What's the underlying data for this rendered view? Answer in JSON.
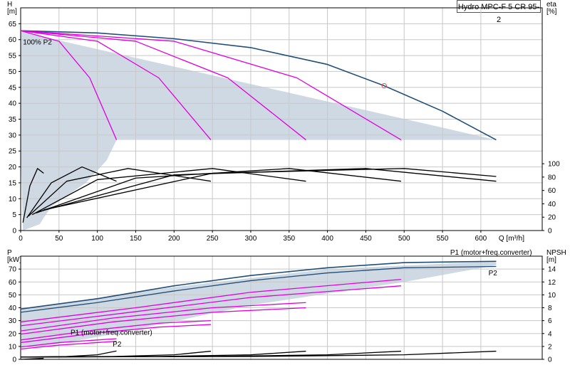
{
  "title": "Hydro MPC-F 5 CR 95-2",
  "colors": {
    "envelope": "#cfd9e4",
    "curve_max": "#1f4e79",
    "curve_speed": "#e000e0",
    "curve_eff": "#000000",
    "grid": "#c8c8c8",
    "marker": "#e05050"
  },
  "chart_data": [
    {
      "type": "line",
      "panel": "head-flow",
      "xlabel": "Q [m³/h]",
      "ylabel_left": [
        "H",
        "[m]"
      ],
      "ylabel_right": [
        "eta",
        "[%]"
      ],
      "x_ticks": [
        0,
        50,
        100,
        150,
        200,
        250,
        300,
        350,
        400,
        450,
        500,
        550,
        600
      ],
      "y_ticks_left": [
        0,
        5,
        10,
        15,
        20,
        25,
        30,
        35,
        40,
        45,
        50,
        55,
        60,
        65
      ],
      "y_ticks_right": [
        0,
        20,
        40,
        60,
        80,
        100
      ],
      "xlim": [
        0,
        680
      ],
      "ylim": [
        0,
        70
      ],
      "grid": true,
      "annotation": "100% P2",
      "duty_point": [
        474,
        45.5
      ],
      "envelope": [
        [
          0,
          62.5
        ],
        [
          620,
          28.5
        ],
        [
          125,
          28.5
        ],
        [
          112,
          22
        ],
        [
          85,
          15
        ],
        [
          40,
          7.5
        ],
        [
          30,
          4
        ],
        [
          25,
          2
        ],
        [
          3,
          0
        ],
        [
          0,
          25
        ]
      ],
      "series": [
        {
          "color": "#1f4e79",
          "role": "max",
          "points": [
            [
              0,
              62.8
            ],
            [
              100,
              62.1
            ],
            [
              200,
              60.3
            ],
            [
              300,
              57.5
            ],
            [
              400,
              52.2
            ],
            [
              474,
              45.5
            ],
            [
              550,
              37.5
            ],
            [
              620,
              28.5
            ]
          ]
        },
        {
          "color": "#e000e0",
          "role": "speed",
          "points": [
            [
              0,
              62.8
            ],
            [
              50,
              59.5
            ],
            [
              90,
              48
            ],
            [
              125,
              28.5
            ]
          ]
        },
        {
          "color": "#e000e0",
          "role": "speed",
          "points": [
            [
              0,
              62.8
            ],
            [
              100,
              59.5
            ],
            [
              180,
              48
            ],
            [
              248,
              28.5
            ]
          ]
        },
        {
          "color": "#e000e0",
          "role": "speed",
          "points": [
            [
              0,
              62.8
            ],
            [
              150,
              59.5
            ],
            [
              270,
              48
            ],
            [
              372,
              28.5
            ]
          ]
        },
        {
          "color": "#e000e0",
          "role": "speed",
          "points": [
            [
              0,
              62.8
            ],
            [
              200,
              59.5
            ],
            [
              360,
              48
            ],
            [
              496,
              28.5
            ]
          ]
        },
        {
          "color": "#000000",
          "role": "eff",
          "points": [
            [
              3,
              2.5
            ],
            [
              12,
              14
            ],
            [
              22,
              19.5
            ],
            [
              30,
              18
            ]
          ]
        },
        {
          "color": "#000000",
          "role": "eff",
          "points": [
            [
              8,
              4
            ],
            [
              40,
              15
            ],
            [
              80,
              20
            ],
            [
              125,
              15.5
            ]
          ]
        },
        {
          "color": "#000000",
          "role": "eff",
          "points": [
            [
              10,
              4.5
            ],
            [
              60,
              15.5
            ],
            [
              140,
              19.5
            ],
            [
              248,
              15.5
            ]
          ]
        },
        {
          "color": "#000000",
          "role": "eff",
          "points": [
            [
              15,
              5
            ],
            [
              100,
              16
            ],
            [
              250,
              19.5
            ],
            [
              372,
              15.5
            ]
          ]
        },
        {
          "color": "#000000",
          "role": "eff",
          "points": [
            [
              20,
              5.5
            ],
            [
              150,
              16.5
            ],
            [
              350,
              19.5
            ],
            [
              496,
              15.5
            ]
          ]
        },
        {
          "color": "#000000",
          "role": "eff",
          "points": [
            [
              25,
              6
            ],
            [
              200,
              17.5
            ],
            [
              450,
              19.5
            ],
            [
              620,
              15.5
            ]
          ]
        },
        {
          "color": "#000000",
          "role": "eff",
          "points": [
            [
              30,
              6.5
            ],
            [
              250,
              18
            ],
            [
              500,
              19.5
            ],
            [
              620,
              17
            ]
          ]
        }
      ]
    },
    {
      "type": "line",
      "panel": "power-npsh",
      "ylabel_left": [
        "P",
        "[kW]"
      ],
      "ylabel_right": [
        "NPSH",
        "[m]"
      ],
      "y_ticks_left": [
        0,
        10,
        20,
        30,
        40,
        50,
        60,
        70
      ],
      "y_ticks_right": [
        0,
        2,
        4,
        6,
        8,
        10,
        12,
        14
      ],
      "xlim": [
        0,
        680
      ],
      "ylim": [
        0,
        80
      ],
      "grid": true,
      "labels": [
        {
          "text": "P1 (motor+freq.converter)",
          "x": 560,
          "y": 81,
          "color": "#1f4e79"
        },
        {
          "text": "P2",
          "x": 610,
          "y": 65,
          "color": "#1f4e79"
        },
        {
          "text": "P1 (motor+freq.converter)",
          "x": 65,
          "y": 19,
          "color": "#b000b0"
        },
        {
          "text": "P2",
          "x": 120,
          "y": 10,
          "color": "#000000"
        }
      ],
      "envelope": [
        [
          0,
          39
        ],
        [
          200,
          56
        ],
        [
          400,
          70
        ],
        [
          620,
          76
        ],
        [
          620,
          73
        ],
        [
          500,
          60
        ],
        [
          300,
          42
        ],
        [
          125,
          20
        ],
        [
          30,
          10
        ],
        [
          0,
          10
        ]
      ],
      "series": [
        {
          "color": "#1f4e79",
          "role": "P1",
          "points": [
            [
              0,
              39
            ],
            [
              100,
              47
            ],
            [
              200,
              57
            ],
            [
              300,
              65
            ],
            [
              400,
              71
            ],
            [
              500,
              75
            ],
            [
              620,
              76
            ]
          ]
        },
        {
          "color": "#1f4e79",
          "role": "P2",
          "points": [
            [
              0,
              36.5
            ],
            [
              100,
              44
            ],
            [
              200,
              53
            ],
            [
              300,
              61
            ],
            [
              400,
              67
            ],
            [
              500,
              71
            ],
            [
              620,
              72
            ]
          ]
        },
        {
          "color": "#e000e0",
          "role": "P1",
          "points": [
            [
              0,
              29
            ],
            [
              150,
              40
            ],
            [
              300,
              52
            ],
            [
              496,
              62
            ]
          ]
        },
        {
          "color": "#e000e0",
          "role": "P2",
          "points": [
            [
              0,
              26
            ],
            [
              150,
              37
            ],
            [
              300,
              48
            ],
            [
              496,
              57
            ]
          ]
        },
        {
          "color": "#e000e0",
          "role": "P1",
          "points": [
            [
              0,
              22
            ],
            [
              120,
              32
            ],
            [
              250,
              40
            ],
            [
              372,
              44
            ]
          ]
        },
        {
          "color": "#e000e0",
          "role": "P2",
          "points": [
            [
              0,
              19.5
            ],
            [
              120,
              29
            ],
            [
              250,
              36.5
            ],
            [
              372,
              40
            ]
          ]
        },
        {
          "color": "#e000e0",
          "role": "P1",
          "points": [
            [
              0,
              15
            ],
            [
              100,
              23
            ],
            [
              180,
              28
            ],
            [
              248,
              30
            ]
          ]
        },
        {
          "color": "#e000e0",
          "role": "P2",
          "points": [
            [
              0,
              13
            ],
            [
              100,
              20.5
            ],
            [
              180,
              25
            ],
            [
              248,
              27
            ]
          ]
        },
        {
          "color": "#e000e0",
          "role": "P1",
          "points": [
            [
              0,
              9.5
            ],
            [
              50,
              13
            ],
            [
              100,
              15
            ],
            [
              125,
              16
            ]
          ]
        },
        {
          "color": "#e000e0",
          "role": "P2",
          "points": [
            [
              0,
              8
            ],
            [
              50,
              11
            ],
            [
              100,
              13
            ],
            [
              125,
              14
            ]
          ]
        },
        {
          "color": "#000000",
          "role": "NPSH",
          "points": [
            [
              0,
              1.8
            ],
            [
              60,
              2.2
            ],
            [
              100,
              3.5
            ],
            [
              125,
              6.5
            ]
          ]
        },
        {
          "color": "#000000",
          "role": "NPSH",
          "points": [
            [
              0,
              1.8
            ],
            [
              120,
              2.2
            ],
            [
              200,
              3.5
            ],
            [
              248,
              6.3
            ]
          ]
        },
        {
          "color": "#000000",
          "role": "NPSH",
          "points": [
            [
              0,
              1.8
            ],
            [
              180,
              2.2
            ],
            [
              300,
              3.5
            ],
            [
              372,
              6.3
            ]
          ]
        },
        {
          "color": "#000000",
          "role": "NPSH",
          "points": [
            [
              0,
              1.8
            ],
            [
              240,
              2.2
            ],
            [
              400,
              3.5
            ],
            [
              496,
              6.3
            ]
          ]
        },
        {
          "color": "#000000",
          "role": "NPSH",
          "points": [
            [
              0,
              1.8
            ],
            [
              300,
              2.2
            ],
            [
              500,
              3.5
            ],
            [
              620,
              6.3
            ]
          ]
        },
        {
          "color": "#000000",
          "role": "NPSH",
          "points": [
            [
              0,
              0
            ],
            [
              15,
              0.4
            ],
            [
              30,
              0.8
            ]
          ]
        }
      ]
    }
  ]
}
